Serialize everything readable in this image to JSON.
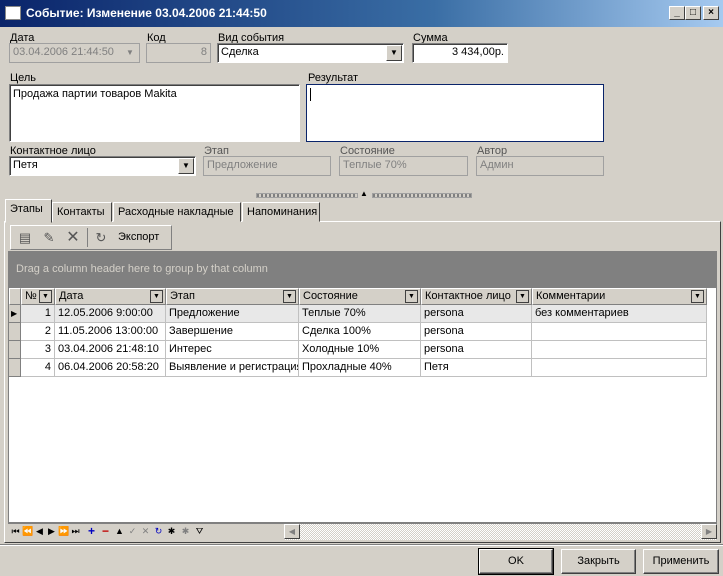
{
  "window": {
    "title": "Событие: Изменение 03.04.2006 21:44:50"
  },
  "form": {
    "date_label": "Дата",
    "date_value": "03.04.2006 21:44:50",
    "code_label": "Код",
    "code_value": "8",
    "event_type_label": "Вид события",
    "event_type_value": "Сделка",
    "sum_label": "Сумма",
    "sum_value": "3 434,00р.",
    "goal_label": "Цель",
    "goal_value": "Продажа партии товаров Makita",
    "result_label": "Результат",
    "result_value": "",
    "contact_label": "Контактное лицо",
    "contact_value": "Петя",
    "stage_label": "Этап",
    "stage_value": "Предложение",
    "state_label": "Состояние",
    "state_value": "Теплые 70%",
    "author_label": "Автор",
    "author_value": "Админ"
  },
  "tabs": [
    {
      "label": "Этапы"
    },
    {
      "label": "Контакты"
    },
    {
      "label": "Расходные накладные"
    },
    {
      "label": "Напоминания"
    }
  ],
  "toolbar": {
    "export_label": "Экспорт"
  },
  "grid": {
    "group_hint": "Drag a column header here to group by that column",
    "columns": [
      "№",
      "Дата",
      "Этап",
      "Состояние",
      "Контактное лицо",
      "Комментарии"
    ],
    "rows": [
      [
        "1",
        "12.05.2006 9:00:00",
        "Предложение",
        "Теплые 70%",
        "persona",
        "без комментариев"
      ],
      [
        "2",
        "11.05.2006 13:00:00",
        "Завершение",
        "Сделка 100%",
        "persona",
        ""
      ],
      [
        "3",
        "03.04.2006 21:48:10",
        "Интерес",
        "Холодные 10%",
        "persona",
        ""
      ],
      [
        "4",
        "06.04.2006 20:58:20",
        "Выявление и регистрация",
        "Прохладные 40%",
        "Петя",
        ""
      ]
    ]
  },
  "buttons": {
    "ok": "OK",
    "close": "Закрыть",
    "apply": "Применить"
  },
  "colors": {
    "titlebar": "#0a246a",
    "window_bg": "#d4d0c8",
    "group_bar": "#808080"
  },
  "icons": [
    "window-icon",
    "minimize-icon",
    "maximize-icon",
    "close-icon",
    "new-record-icon",
    "edit-record-icon",
    "delete-icon",
    "refresh-icon"
  ]
}
